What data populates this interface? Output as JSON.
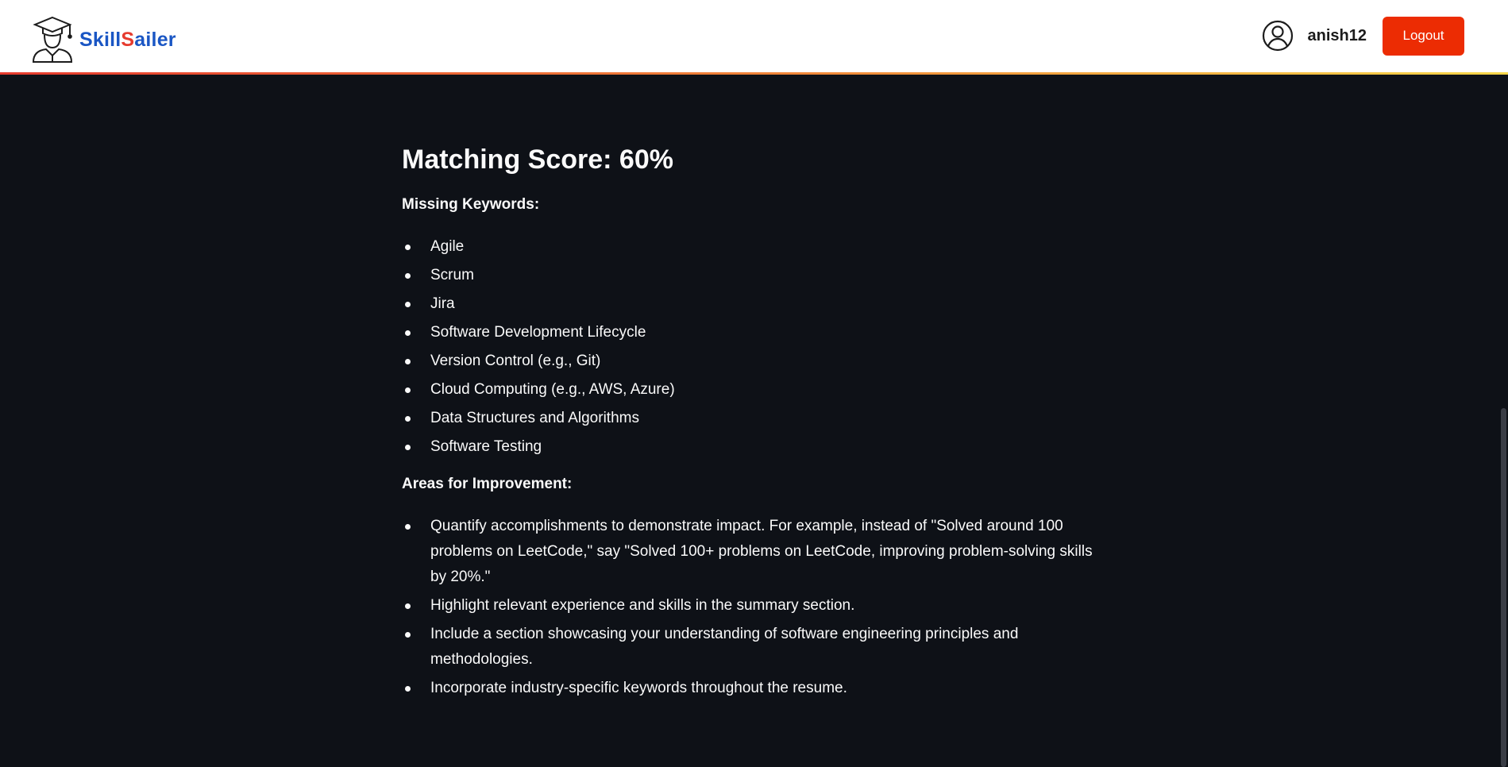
{
  "brand": {
    "name_prefix": "Skill",
    "name_accent": "S",
    "name_suffix": "ailer",
    "color": "#1a56c4",
    "accent_color": "#e63b2e"
  },
  "user": {
    "username": "anish12",
    "logout_label": "Logout"
  },
  "result": {
    "score_heading": "Matching Score: 60%",
    "missing_title": "Missing Keywords:",
    "missing_keywords": [
      "Agile",
      "Scrum",
      "Jira",
      "Software Development Lifecycle",
      "Version Control (e.g., Git)",
      "Cloud Computing (e.g., AWS, Azure)",
      "Data Structures and Algorithms",
      "Software Testing"
    ],
    "improvement_title": "Areas for Improvement:",
    "improvements": [
      "Quantify accomplishments to demonstrate impact. For example, instead of \"Solved around 100 problems on LeetCode,\" say \"Solved 100+ problems on LeetCode, improving problem-solving skills by 20%.\"",
      "Highlight relevant experience and skills in the summary section.",
      "Include a section showcasing your understanding of software engineering principles and methodologies.",
      "Incorporate industry-specific keywords throughout the resume."
    ]
  },
  "colors": {
    "background": "#0e1117",
    "logout_button": "#ec2c03",
    "navbar": "#ffffff"
  },
  "icons": {
    "logo": "graduate-logo-icon",
    "avatar": "user-circle-icon"
  }
}
